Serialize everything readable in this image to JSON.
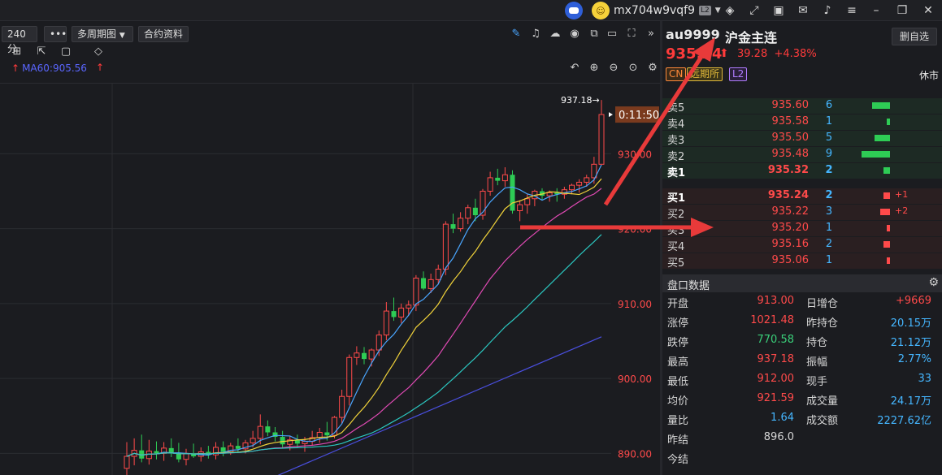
{
  "titlebar": {
    "username": "mx704w9vqf9",
    "level": "L2"
  },
  "toolbar": {
    "period": "240分",
    "more": "•••",
    "multi_period": "多周期图",
    "contract_info": "合约资料"
  },
  "indicator": {
    "ma60": "MA60:905.56"
  },
  "chart_data": {
    "type": "candlestick",
    "y_tick_labels": [
      "930.00",
      "920.00",
      "910.00",
      "900.00",
      "890.00"
    ],
    "ylim": [
      887.0,
      938.5
    ],
    "high_label": "937.18",
    "countdown": "0:11:50",
    "candles": [
      {
        "o": 888.0,
        "h": 891.5,
        "l": 887.0,
        "c": 889.6
      },
      {
        "o": 889.6,
        "h": 892.0,
        "l": 888.4,
        "c": 890.4
      },
      {
        "o": 890.4,
        "h": 892.5,
        "l": 888.8,
        "c": 889.3
      },
      {
        "o": 889.3,
        "h": 891.8,
        "l": 888.5,
        "c": 890.3
      },
      {
        "o": 890.3,
        "h": 891.6,
        "l": 889.2,
        "c": 890.0
      },
      {
        "o": 890.0,
        "h": 891.5,
        "l": 889.0,
        "c": 890.7
      },
      {
        "o": 890.7,
        "h": 892.0,
        "l": 889.5,
        "c": 890.1
      },
      {
        "o": 890.1,
        "h": 891.4,
        "l": 888.8,
        "c": 889.2
      },
      {
        "o": 889.2,
        "h": 890.6,
        "l": 888.4,
        "c": 890.0
      },
      {
        "o": 890.0,
        "h": 891.3,
        "l": 889.4,
        "c": 889.6
      },
      {
        "o": 889.6,
        "h": 890.8,
        "l": 888.9,
        "c": 890.2
      },
      {
        "o": 890.2,
        "h": 891.0,
        "l": 889.3,
        "c": 889.8
      },
      {
        "o": 889.8,
        "h": 891.5,
        "l": 889.2,
        "c": 890.8
      },
      {
        "o": 890.8,
        "h": 891.6,
        "l": 889.6,
        "c": 890.2
      },
      {
        "o": 890.2,
        "h": 891.4,
        "l": 889.8,
        "c": 891.0
      },
      {
        "o": 891.0,
        "h": 892.0,
        "l": 890.2,
        "c": 890.6
      },
      {
        "o": 890.6,
        "h": 891.8,
        "l": 890.0,
        "c": 891.4
      },
      {
        "o": 891.4,
        "h": 893.0,
        "l": 890.8,
        "c": 892.0
      },
      {
        "o": 892.0,
        "h": 895.2,
        "l": 891.2,
        "c": 893.6
      },
      {
        "o": 893.6,
        "h": 894.4,
        "l": 892.3,
        "c": 892.8
      },
      {
        "o": 892.8,
        "h": 893.5,
        "l": 891.6,
        "c": 892.2
      },
      {
        "o": 892.2,
        "h": 893.0,
        "l": 890.8,
        "c": 891.2
      },
      {
        "o": 891.2,
        "h": 892.3,
        "l": 890.4,
        "c": 891.8
      },
      {
        "o": 891.8,
        "h": 892.5,
        "l": 890.8,
        "c": 891.3
      },
      {
        "o": 891.3,
        "h": 892.2,
        "l": 890.2,
        "c": 891.6
      },
      {
        "o": 891.6,
        "h": 893.0,
        "l": 891.0,
        "c": 892.1
      },
      {
        "o": 892.1,
        "h": 893.4,
        "l": 891.4,
        "c": 892.8
      },
      {
        "o": 892.8,
        "h": 894.2,
        "l": 891.7,
        "c": 892.4
      },
      {
        "o": 892.4,
        "h": 895.0,
        "l": 892.0,
        "c": 894.8
      },
      {
        "o": 894.8,
        "h": 898.5,
        "l": 894.0,
        "c": 897.6
      },
      {
        "o": 897.6,
        "h": 903.2,
        "l": 896.4,
        "c": 902.8
      },
      {
        "o": 902.8,
        "h": 904.3,
        "l": 901.8,
        "c": 903.4
      },
      {
        "o": 903.4,
        "h": 904.2,
        "l": 901.9,
        "c": 902.6
      },
      {
        "o": 902.6,
        "h": 904.0,
        "l": 901.6,
        "c": 903.8
      },
      {
        "o": 903.8,
        "h": 906.4,
        "l": 903.0,
        "c": 905.8
      },
      {
        "o": 905.8,
        "h": 910.2,
        "l": 905.1,
        "c": 909.0
      },
      {
        "o": 909.0,
        "h": 910.8,
        "l": 907.7,
        "c": 908.2
      },
      {
        "o": 908.2,
        "h": 910.0,
        "l": 907.4,
        "c": 909.4
      },
      {
        "o": 909.4,
        "h": 910.4,
        "l": 908.4,
        "c": 909.8
      },
      {
        "o": 909.8,
        "h": 913.8,
        "l": 909.0,
        "c": 913.4
      },
      {
        "o": 913.4,
        "h": 914.3,
        "l": 911.8,
        "c": 912.0
      },
      {
        "o": 912.0,
        "h": 914.0,
        "l": 911.4,
        "c": 913.2
      },
      {
        "o": 913.2,
        "h": 915.2,
        "l": 912.6,
        "c": 914.6
      },
      {
        "o": 914.6,
        "h": 921.0,
        "l": 913.8,
        "c": 920.6
      },
      {
        "o": 920.6,
        "h": 922.0,
        "l": 919.4,
        "c": 920.0
      },
      {
        "o": 920.0,
        "h": 922.2,
        "l": 919.6,
        "c": 921.4
      },
      {
        "o": 921.4,
        "h": 923.2,
        "l": 920.6,
        "c": 922.8
      },
      {
        "o": 922.8,
        "h": 924.0,
        "l": 921.0,
        "c": 921.8
      },
      {
        "o": 921.8,
        "h": 925.3,
        "l": 921.2,
        "c": 925.0
      },
      {
        "o": 925.0,
        "h": 927.6,
        "l": 924.4,
        "c": 926.8
      },
      {
        "o": 926.8,
        "h": 928.0,
        "l": 925.8,
        "c": 926.4
      },
      {
        "o": 926.4,
        "h": 928.2,
        "l": 925.6,
        "c": 927.2
      },
      {
        "o": 927.2,
        "h": 927.8,
        "l": 922.0,
        "c": 922.4
      },
      {
        "o": 922.4,
        "h": 923.8,
        "l": 921.0,
        "c": 923.2
      },
      {
        "o": 923.2,
        "h": 924.6,
        "l": 922.0,
        "c": 924.0
      },
      {
        "o": 924.0,
        "h": 925.2,
        "l": 923.0,
        "c": 925.0
      },
      {
        "o": 925.0,
        "h": 925.4,
        "l": 923.8,
        "c": 924.4
      },
      {
        "o": 924.4,
        "h": 925.1,
        "l": 923.6,
        "c": 924.8
      },
      {
        "o": 924.8,
        "h": 925.4,
        "l": 923.6,
        "c": 924.6
      },
      {
        "o": 924.6,
        "h": 925.6,
        "l": 924.0,
        "c": 925.2
      },
      {
        "o": 925.2,
        "h": 926.0,
        "l": 924.6,
        "c": 925.8
      },
      {
        "o": 925.8,
        "h": 926.6,
        "l": 924.8,
        "c": 926.2
      },
      {
        "o": 926.2,
        "h": 927.2,
        "l": 925.6,
        "c": 926.8
      },
      {
        "o": 926.8,
        "h": 929.6,
        "l": 926.0,
        "c": 928.6
      },
      {
        "o": 928.6,
        "h": 937.18,
        "l": 934.7,
        "c": 935.24
      }
    ]
  },
  "quote": {
    "symbol": "au9999",
    "name": "沪金主连",
    "delete_btn": "删自选",
    "price": "935.24",
    "change": "39.28",
    "change_pct": "+4.38%",
    "tags": [
      "CN",
      "远期所",
      "L2"
    ],
    "status": "休市"
  },
  "orderbook": {
    "sell": [
      {
        "label": "卖5",
        "price": "935.60",
        "qty": "6",
        "bar": 0.35
      },
      {
        "label": "卖4",
        "price": "935.58",
        "qty": "1",
        "bar": 0.06
      },
      {
        "label": "卖3",
        "price": "935.50",
        "qty": "5",
        "bar": 0.3
      },
      {
        "label": "卖2",
        "price": "935.48",
        "qty": "9",
        "bar": 0.55
      },
      {
        "label": "卖1",
        "price": "935.32",
        "qty": "2",
        "bar": 0.12
      }
    ],
    "buy": [
      {
        "label": "买1",
        "price": "935.24",
        "qty": "2",
        "bar": 0.12,
        "delta": "+1"
      },
      {
        "label": "买2",
        "price": "935.22",
        "qty": "3",
        "bar": 0.18,
        "delta": "+2"
      },
      {
        "label": "买3",
        "price": "935.20",
        "qty": "1",
        "bar": 0.06,
        "delta": ""
      },
      {
        "label": "买4",
        "price": "935.16",
        "qty": "2",
        "bar": 0.12,
        "delta": ""
      },
      {
        "label": "买5",
        "price": "935.06",
        "qty": "1",
        "bar": 0.06,
        "delta": ""
      }
    ]
  },
  "stats_header": "盘口数据",
  "stats": [
    {
      "k1": "开盘",
      "v1": "913.00",
      "c1": "#ff4a4a",
      "k2": "日增仓",
      "v2": "+9669",
      "c2": "#ff4a4a"
    },
    {
      "k1": "涨停",
      "v1": "1021.48",
      "c1": "#ff4a4a",
      "k2": "昨持仓",
      "v2": "20.15万",
      "c2": "#45b6ff"
    },
    {
      "k1": "跌停",
      "v1": "770.58",
      "c1": "#3ad07a",
      "k2": "持仓",
      "v2": "21.12万",
      "c2": "#45b6ff"
    },
    {
      "k1": "最高",
      "v1": "937.18",
      "c1": "#ff4a4a",
      "k2": "振幅",
      "v2": "2.77%",
      "c2": "#45b6ff"
    },
    {
      "k1": "最低",
      "v1": "912.00",
      "c1": "#ff4a4a",
      "k2": "现手",
      "v2": "33",
      "c2": "#45b6ff"
    },
    {
      "k1": "均价",
      "v1": "921.59",
      "c1": "#ff4a4a",
      "k2": "成交量",
      "v2": "24.17万",
      "c2": "#45b6ff"
    },
    {
      "k1": "量比",
      "v1": "1.64",
      "c1": "#45b6ff",
      "k2": "成交额",
      "v2": "2227.62亿",
      "c2": "#45b6ff"
    },
    {
      "k1": "昨结",
      "v1": "896.0",
      "c1": "#d6d6d6",
      "k2": "",
      "v2": "",
      "c2": "#45b6ff"
    },
    {
      "k1": "今结",
      "v1": "",
      "c1": "#d6d6d6",
      "k2": "",
      "v2": "",
      "c2": "#45b6ff"
    }
  ],
  "colors": {
    "up": "#ff4a4a",
    "down": "#2ecc55",
    "ma5": "#4aa6ff",
    "ma10": "#f0d23a",
    "ma20": "#e04ab4",
    "ma30": "#2bc7c0",
    "ma60": "#4a4fe0",
    "arrow": "#e83a3a"
  }
}
